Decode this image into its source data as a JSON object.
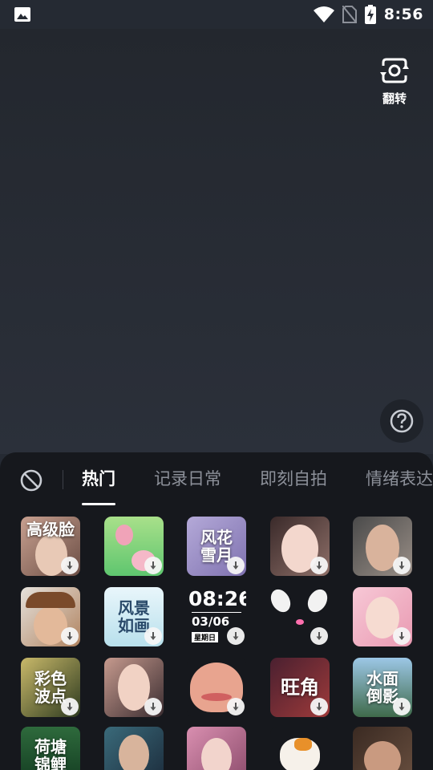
{
  "status": {
    "time": "8:56"
  },
  "camera": {
    "flip_label": "翻转",
    "help_icon": "question-icon"
  },
  "panel": {
    "tabs": [
      {
        "label": "热门",
        "active": true
      },
      {
        "label": "记录日常",
        "active": false
      },
      {
        "label": "即刻自拍",
        "active": false
      },
      {
        "label": "情绪表达",
        "active": false
      }
    ],
    "effects": [
      [
        "高级脸",
        "",
        "风花\n雪月",
        "",
        ""
      ],
      [
        "",
        "风景\n如画",
        "08:26",
        "",
        ""
      ],
      [
        "彩色\n波点",
        "",
        "",
        "旺角",
        "水面\n倒影"
      ],
      [
        "荷塘\n锦鲤",
        "",
        "",
        "",
        ""
      ]
    ],
    "clock": {
      "time": "08:26",
      "date": "03/06",
      "weekday": "星期日"
    }
  }
}
